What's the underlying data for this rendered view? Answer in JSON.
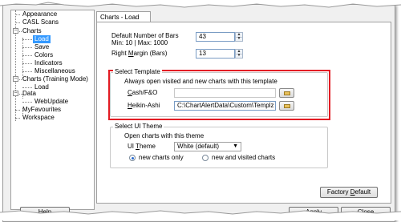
{
  "sidebar": {
    "items": [
      {
        "label": "Appearance"
      },
      {
        "label": "CASL Scans"
      },
      {
        "label": "Charts"
      },
      {
        "label": "Load"
      },
      {
        "label": "Save"
      },
      {
        "label": "Colors"
      },
      {
        "label": "Indicators"
      },
      {
        "label": "Miscellaneous"
      },
      {
        "label": "Charts (Training Mode)"
      },
      {
        "label": "Load"
      },
      {
        "label": "Data"
      },
      {
        "label": "WebUpdate"
      },
      {
        "label": "MyFavourites"
      },
      {
        "label": "Workspace"
      }
    ],
    "selected": "Load"
  },
  "tab": {
    "label": "Charts - Load"
  },
  "bars": {
    "label": "Default Number of Bars",
    "range": "Min: 10  |  Max: 1000",
    "value": "43"
  },
  "margin": {
    "label_prefix": "Right ",
    "label_underlined": "M",
    "label_suffix": "argin (Bars)",
    "value": "13"
  },
  "template": {
    "title": "Select Template",
    "description": "Always open visited and new charts with this template",
    "cash_label_underlined": "C",
    "cash_label_rest": "ash/F&O",
    "cash_value": "",
    "heikin_label_underlined": "H",
    "heikin_label_rest": "eikin-Ashi",
    "heikin_value": "C:\\ChartAlertData\\Custom\\Templz"
  },
  "theme": {
    "title": "Select UI Theme",
    "description": "Open charts with this theme",
    "label_prefix": "UI ",
    "label_underlined": "T",
    "label_suffix": "heme",
    "selected": "White (default)",
    "radio_new": "new charts only",
    "radio_all": "new and visited charts",
    "radio_selected": "new charts only"
  },
  "buttons": {
    "factory_prefix": "Factory ",
    "factory_underlined": "D",
    "factory_suffix": "efault",
    "help": "Help",
    "apply": "Apply",
    "close": "Close"
  },
  "colors": {
    "highlight": "#e31b23",
    "selection": "#3399ff"
  }
}
